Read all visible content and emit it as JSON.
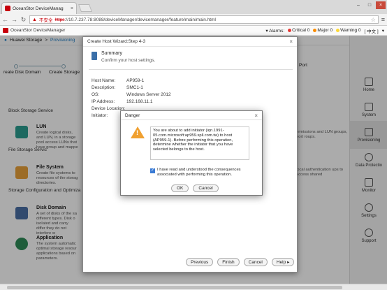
{
  "browser": {
    "tab_title": "OceanStor DeviceManag",
    "url_warning": "不安全",
    "url_scheme": "https",
    "url_rest": "://10.7.237.78:8088/deviceManager/devicemanager/feature/main/main.html"
  },
  "header": {
    "brand": "OceanStor DeviceManager",
    "alarms_label": "Alarms:",
    "critical": "Critical 0",
    "major": "Major 0",
    "warning": "Warning 0",
    "lang": "[ 中文 ]",
    "critical_color": "#e53935",
    "major_color": "#fb8c00",
    "warning_color": "#fdd835"
  },
  "breadcrumb": {
    "root": "Huawei Storage",
    "sep": ">",
    "current": "Provisioning"
  },
  "flow": {
    "step1": "reate Disk Domain",
    "step2": "Create Storage",
    "step3": "Port"
  },
  "sections": {
    "block": "Block Storage Service",
    "file": "File Storage Servic",
    "config": "Storage Configuration and Optimiza"
  },
  "services": {
    "lun_title": "LUN",
    "lun_desc": "Create logical disks, and LUN, in a storage pool access LUNs that have group and mappe",
    "fs_title": "File System",
    "fs_desc": "Create file systems to resources of the storag directories.",
    "dd_title": "Disk Domain",
    "dd_desc": "A set of disks of the sa different types. Disk o isolated and carry differ they do not interfere w",
    "app_title": "Application",
    "app_desc": "The system automatic optimal storage resour applications based on parameters.",
    "right1": "ermissions and LUN groups, port roups.",
    "right2": "local authentication ups to access shared"
  },
  "sidebar": {
    "items": [
      "Home",
      "System",
      "Provisioning",
      "Data Protectio",
      "Monitor",
      "Settings",
      "Support"
    ]
  },
  "wizard": {
    "title": "Create Host Wizard:Step 4-3",
    "summary_title": "Summary",
    "summary_sub": "Confirm your host settings.",
    "fields": [
      {
        "label": "Host Name:",
        "value": "AP959-1"
      },
      {
        "label": "Description:",
        "value": "SMC1-1"
      },
      {
        "label": "OS:",
        "value": "Windows Server 2012"
      },
      {
        "label": "IP Address:",
        "value": "192.168.11.1"
      },
      {
        "label": "Device Location:",
        "value": ""
      },
      {
        "label": "Initiator:",
        "value": ""
      }
    ],
    "buttons": {
      "previous": "Previous",
      "finish": "Finish",
      "cancel": "Cancel",
      "help": "Help"
    }
  },
  "danger": {
    "title": "Danger",
    "message": "You are about to add initiator (iqn.1991-05.com.microsoft:ap959.spll.com.tw) to host (AP959-1). Before performing this operation, determine whether the initiator that you have selected belongs to the host.",
    "checkbox_label": "I have read and understood the consequences associated with performing this operation.",
    "ok": "OK",
    "cancel": "Cancel"
  }
}
